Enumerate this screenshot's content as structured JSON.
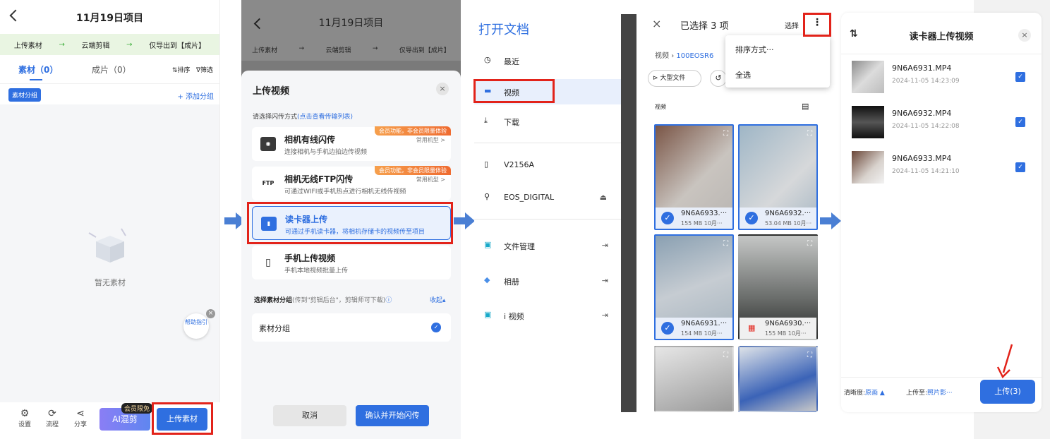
{
  "p1": {
    "title": "11月19日项目",
    "steps": [
      "上传素材",
      "云端剪辑",
      "仅导出到【成片】"
    ],
    "step_arrow": "→",
    "tab_materials": "素材（0）",
    "tab_finished": "成片（0）",
    "sort": "排序",
    "filter": "筛选",
    "group_btn": "素材分组",
    "add_group": "+ 添加分组",
    "empty": "暂无素材",
    "help": "帮助指引",
    "bottom": [
      "设置",
      "流程",
      "分享"
    ],
    "vip": "会员限免",
    "ai": "AI混剪",
    "upload": "上传素材"
  },
  "p2": {
    "title": "11月19日项目",
    "steps": [
      "上传素材",
      "云端剪辑",
      "仅导出到【成片】"
    ],
    "sheet_title": "上传视频",
    "choose": "请选择闪传方式",
    "choose_link": "(点击查看传输列表)",
    "cards": [
      {
        "icon": "camera-icon",
        "title": "相机有线闪传",
        "desc": "连接相机与手机边拍边传视频",
        "right": "常用机型 >",
        "badge": "会员功能，非会员限量体验"
      },
      {
        "icon": "ftp-icon",
        "title": "相机无线FTP闪传",
        "desc": "可通过WIFI或手机热点进行相机无线传视频",
        "right": "常用机型 >",
        "badge": "会员功能，非会员限量体验"
      },
      {
        "icon": "usb-icon",
        "title": "读卡器上传",
        "desc": "可通过手机读卡器，将相机存储卡的视频传至项目"
      },
      {
        "icon": "phone-icon",
        "title": "手机上传视频",
        "desc": "手机本地视频批量上传"
      }
    ],
    "ftp_label": "FTP",
    "group_label": "选择素材分组",
    "group_hint": "(传到\"剪辑后台\"，剪辑师可下载)",
    "collapse": "收起▴",
    "group_item": "素材分组",
    "cancel": "取消",
    "confirm": "确认并开始闪传"
  },
  "p3": {
    "title": "打开文档",
    "items": [
      "最近",
      "视频",
      "下载",
      "V2156A",
      "EOS_DIGITAL",
      "文件管理",
      "相册",
      "i 视频"
    ]
  },
  "p4": {
    "selected": "已选择 3 项",
    "select": "选择",
    "crumb1": "视频",
    "crumb2": "100EOSR6",
    "chip": "大型文件",
    "section": "视频",
    "menu": [
      "排序方式···",
      "全选"
    ],
    "tiles": [
      {
        "name": "9N6A6933.···",
        "size": "155 MB 10月···",
        "selected": true
      },
      {
        "name": "9N6A6932.···",
        "size": "53.04 MB 10月···",
        "selected": true
      },
      {
        "name": "9N6A6931.···",
        "size": "154 MB 10月···",
        "selected": true
      },
      {
        "name": "9N6A6930.···",
        "size": "155 MB 10月···",
        "selected": false
      }
    ]
  },
  "p5": {
    "title": "读卡器上传视频",
    "files": [
      {
        "name": "9N6A6931.MP4",
        "date": "2024-11-05 14:23:09"
      },
      {
        "name": "9N6A6932.MP4",
        "date": "2024-11-05 14:22:08"
      },
      {
        "name": "9N6A6933.MP4",
        "date": "2024-11-05 14:21:10"
      }
    ],
    "clarity_label": "清晰度:",
    "clarity_val": "原画 ▲",
    "upload_to_label": "上传至:",
    "upload_to_val": "照片影···",
    "upload_btn": "上传(3)"
  },
  "colors": {
    "accent": "#2f6fe0",
    "highlight": "#e2231a",
    "arrow": "#4a7fd4"
  }
}
